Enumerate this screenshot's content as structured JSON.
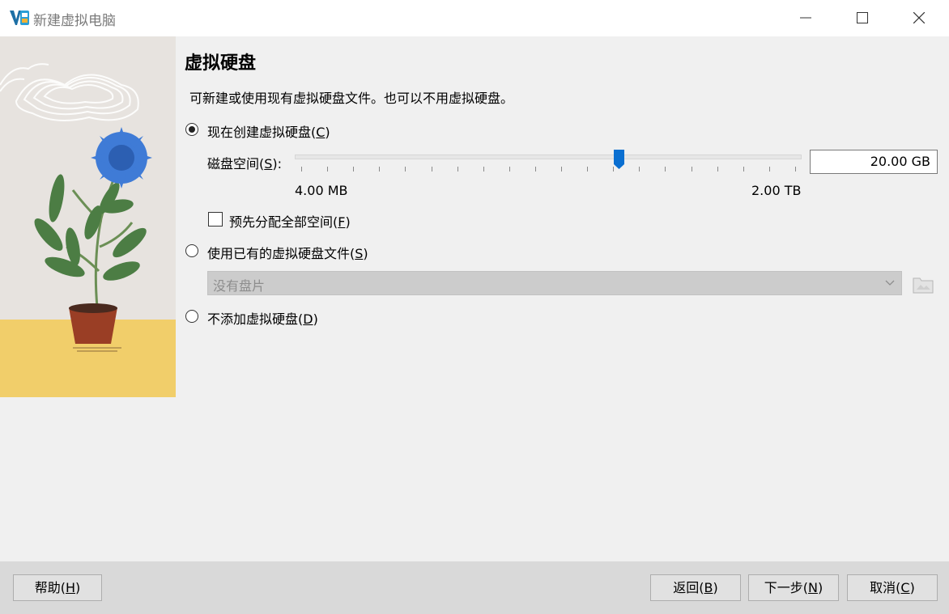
{
  "window": {
    "title": "新建虚拟电脑"
  },
  "page": {
    "heading": "虚拟硬盘",
    "description": "可新建或使用现有虚拟硬盘文件。也可以不用虚拟硬盘。"
  },
  "options": {
    "create_new": {
      "label": "现在创建虚拟硬盘(",
      "mnemonic": "C",
      "suffix": ")",
      "selected": true
    },
    "disk_size": {
      "label": "磁盘空间(",
      "mnemonic": "S",
      "suffix": "):",
      "value": "20.00 GB",
      "min_label": "4.00 MB",
      "max_label": "2.00 TB",
      "slider_fraction": 0.64
    },
    "preallocate": {
      "label": "预先分配全部空间(",
      "mnemonic": "F",
      "suffix": ")",
      "checked": false
    },
    "use_existing": {
      "label": "使用已有的虚拟硬盘文件(",
      "mnemonic": "S",
      "suffix": ")",
      "selected": false
    },
    "existing_combo": {
      "value": "没有盘片"
    },
    "no_disk": {
      "label": "不添加虚拟硬盘(",
      "mnemonic": "D",
      "suffix": ")",
      "selected": false
    }
  },
  "buttons": {
    "help": {
      "label": "帮助(",
      "mnemonic": "H",
      "suffix": ")"
    },
    "back": {
      "label": "返回(",
      "mnemonic": "B",
      "suffix": ")"
    },
    "next": {
      "label": "下一步(",
      "mnemonic": "N",
      "suffix": ")"
    },
    "cancel": {
      "label": "取消(",
      "mnemonic": "C",
      "suffix": ")"
    }
  },
  "colors": {
    "accent": "#0a6fd1",
    "illustration_wall": "#e7e3df",
    "illustration_floor": "#f1ce6a"
  }
}
